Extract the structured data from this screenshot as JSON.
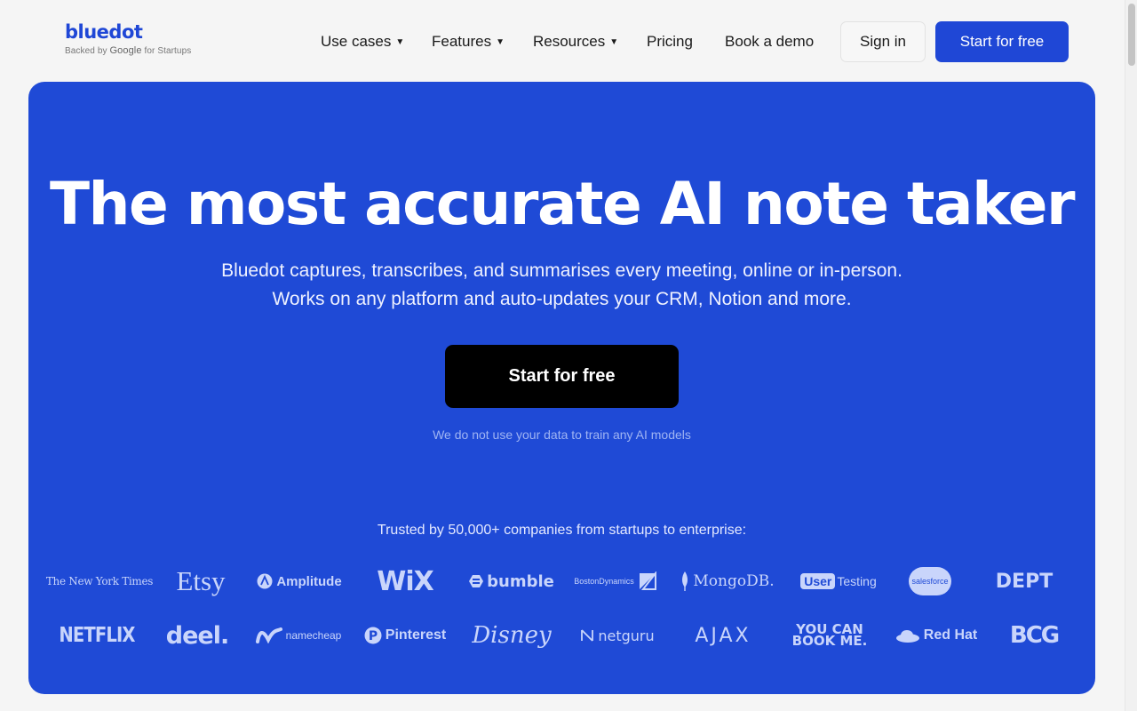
{
  "header": {
    "logo": {
      "word": "bluedot",
      "sub_prefix": "Backed by",
      "sub_brand": "Google",
      "sub_suffix": "for Startups"
    },
    "nav": [
      {
        "label": "Use cases",
        "has_caret": true
      },
      {
        "label": "Features",
        "has_caret": true
      },
      {
        "label": "Resources",
        "has_caret": true
      },
      {
        "label": "Pricing",
        "has_caret": false
      },
      {
        "label": "Book a demo",
        "has_caret": false
      }
    ],
    "sign_in_label": "Sign in",
    "start_label": "Start for free"
  },
  "hero": {
    "title": "The most accurate AI note taker",
    "subtitle_line1": "Bluedot captures, transcribes, and summarises every meeting, online or in-person.",
    "subtitle_line2": "Works on any platform and auto-updates your CRM, Notion and more.",
    "cta_label": "Start for free",
    "note": "We do not use your data to train any AI models",
    "trusted_text": "Trusted by 50,000+ companies from startups to enterprise:"
  },
  "logos": {
    "row1": [
      "The New York Times",
      "Etsy",
      "Amplitude",
      "WiX",
      "bumble",
      "BostonDynamics",
      "MongoDB.",
      "User",
      "Testing",
      "salesforce",
      "DEPT"
    ],
    "row2": [
      "NETFLIX",
      "deel.",
      "namecheap",
      "Pinterest",
      "Disney",
      "netguru",
      "AJAX",
      "YOU CAN",
      "BOOK ME.",
      "Red Hat",
      "BCG"
    ]
  },
  "colors": {
    "brand": "#1f47d6",
    "hero_bg": "#1f4ad6",
    "cta_bg": "#000000"
  }
}
